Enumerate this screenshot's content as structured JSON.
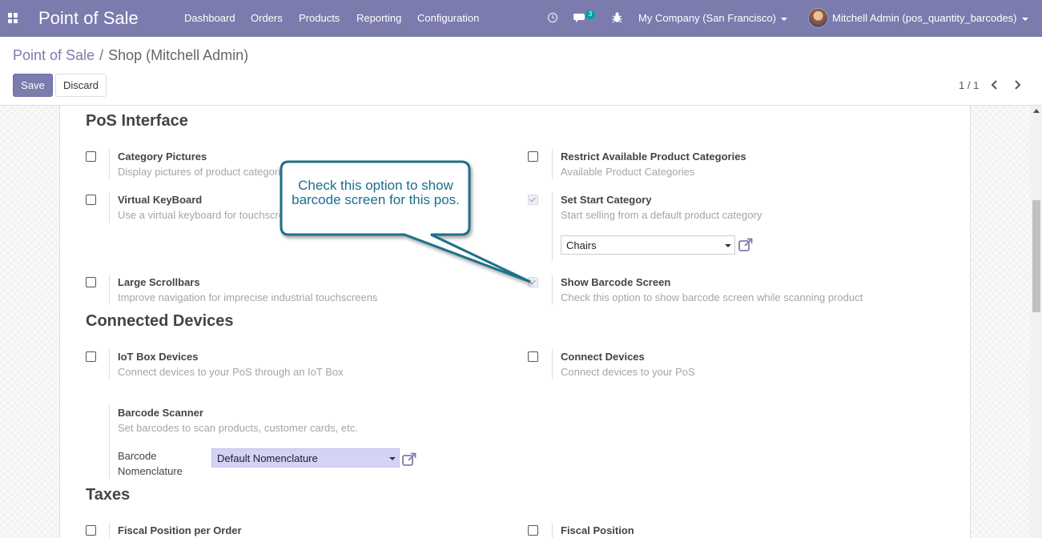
{
  "navbar": {
    "brand": "Point of Sale",
    "menu": [
      "Dashboard",
      "Orders",
      "Products",
      "Reporting",
      "Configuration"
    ],
    "messages_count": "3",
    "company": "My Company (San Francisco)",
    "user": "Mitchell Admin (pos_quantity_barcodes)"
  },
  "breadcrumb": {
    "parent": "Point of Sale",
    "separator": "/",
    "current": "Shop (Mitchell Admin)"
  },
  "buttons": {
    "save": "Save",
    "discard": "Discard"
  },
  "pager": {
    "value": "1 / 1"
  },
  "sections": {
    "pos_interface": "PoS Interface",
    "connected_devices": "Connected Devices",
    "taxes": "Taxes"
  },
  "settings": {
    "category_pictures": {
      "title": "Category Pictures",
      "desc": "Display pictures of product categories",
      "checked": false
    },
    "virtual_keyboard": {
      "title": "Virtual KeyBoard",
      "desc": "Use a virtual keyboard for touchscreens",
      "checked": false
    },
    "large_scrollbars": {
      "title": "Large Scrollbars",
      "desc": "Improve navigation for imprecise industrial touchscreens",
      "checked": false
    },
    "restrict_categories": {
      "title": "Restrict Available Product Categories",
      "desc": "Available Product Categories",
      "checked": false
    },
    "start_category": {
      "title": "Set Start Category",
      "desc": "Start selling from a default product category",
      "checked": true,
      "value": "Chairs"
    },
    "barcode_screen": {
      "title": "Show Barcode Screen",
      "desc": "Check this option to show barcode screen while scanning product",
      "checked": true
    },
    "iot_box": {
      "title": "IoT Box Devices",
      "desc": "Connect devices to your PoS through an IoT Box",
      "checked": false
    },
    "connect_devices": {
      "title": "Connect Devices",
      "desc": "Connect devices to your PoS",
      "checked": false
    },
    "barcode_scanner": {
      "title": "Barcode Scanner",
      "desc": "Set barcodes to scan products, customer cards, etc.",
      "label_line1": "Barcode",
      "label_line2": "Nomenclature",
      "value": "Default Nomenclature"
    },
    "fiscal_position_order": {
      "title": "Fiscal Position per Order",
      "checked": false
    },
    "fiscal_position": {
      "title": "Fiscal Position",
      "checked": false
    }
  },
  "callout": {
    "line1": "Check this option to show",
    "line2": "barcode screen for this pos.",
    "color": "#1a6e90"
  },
  "colors": {
    "primary": "#7c7bad",
    "badge": "#00a09d"
  }
}
